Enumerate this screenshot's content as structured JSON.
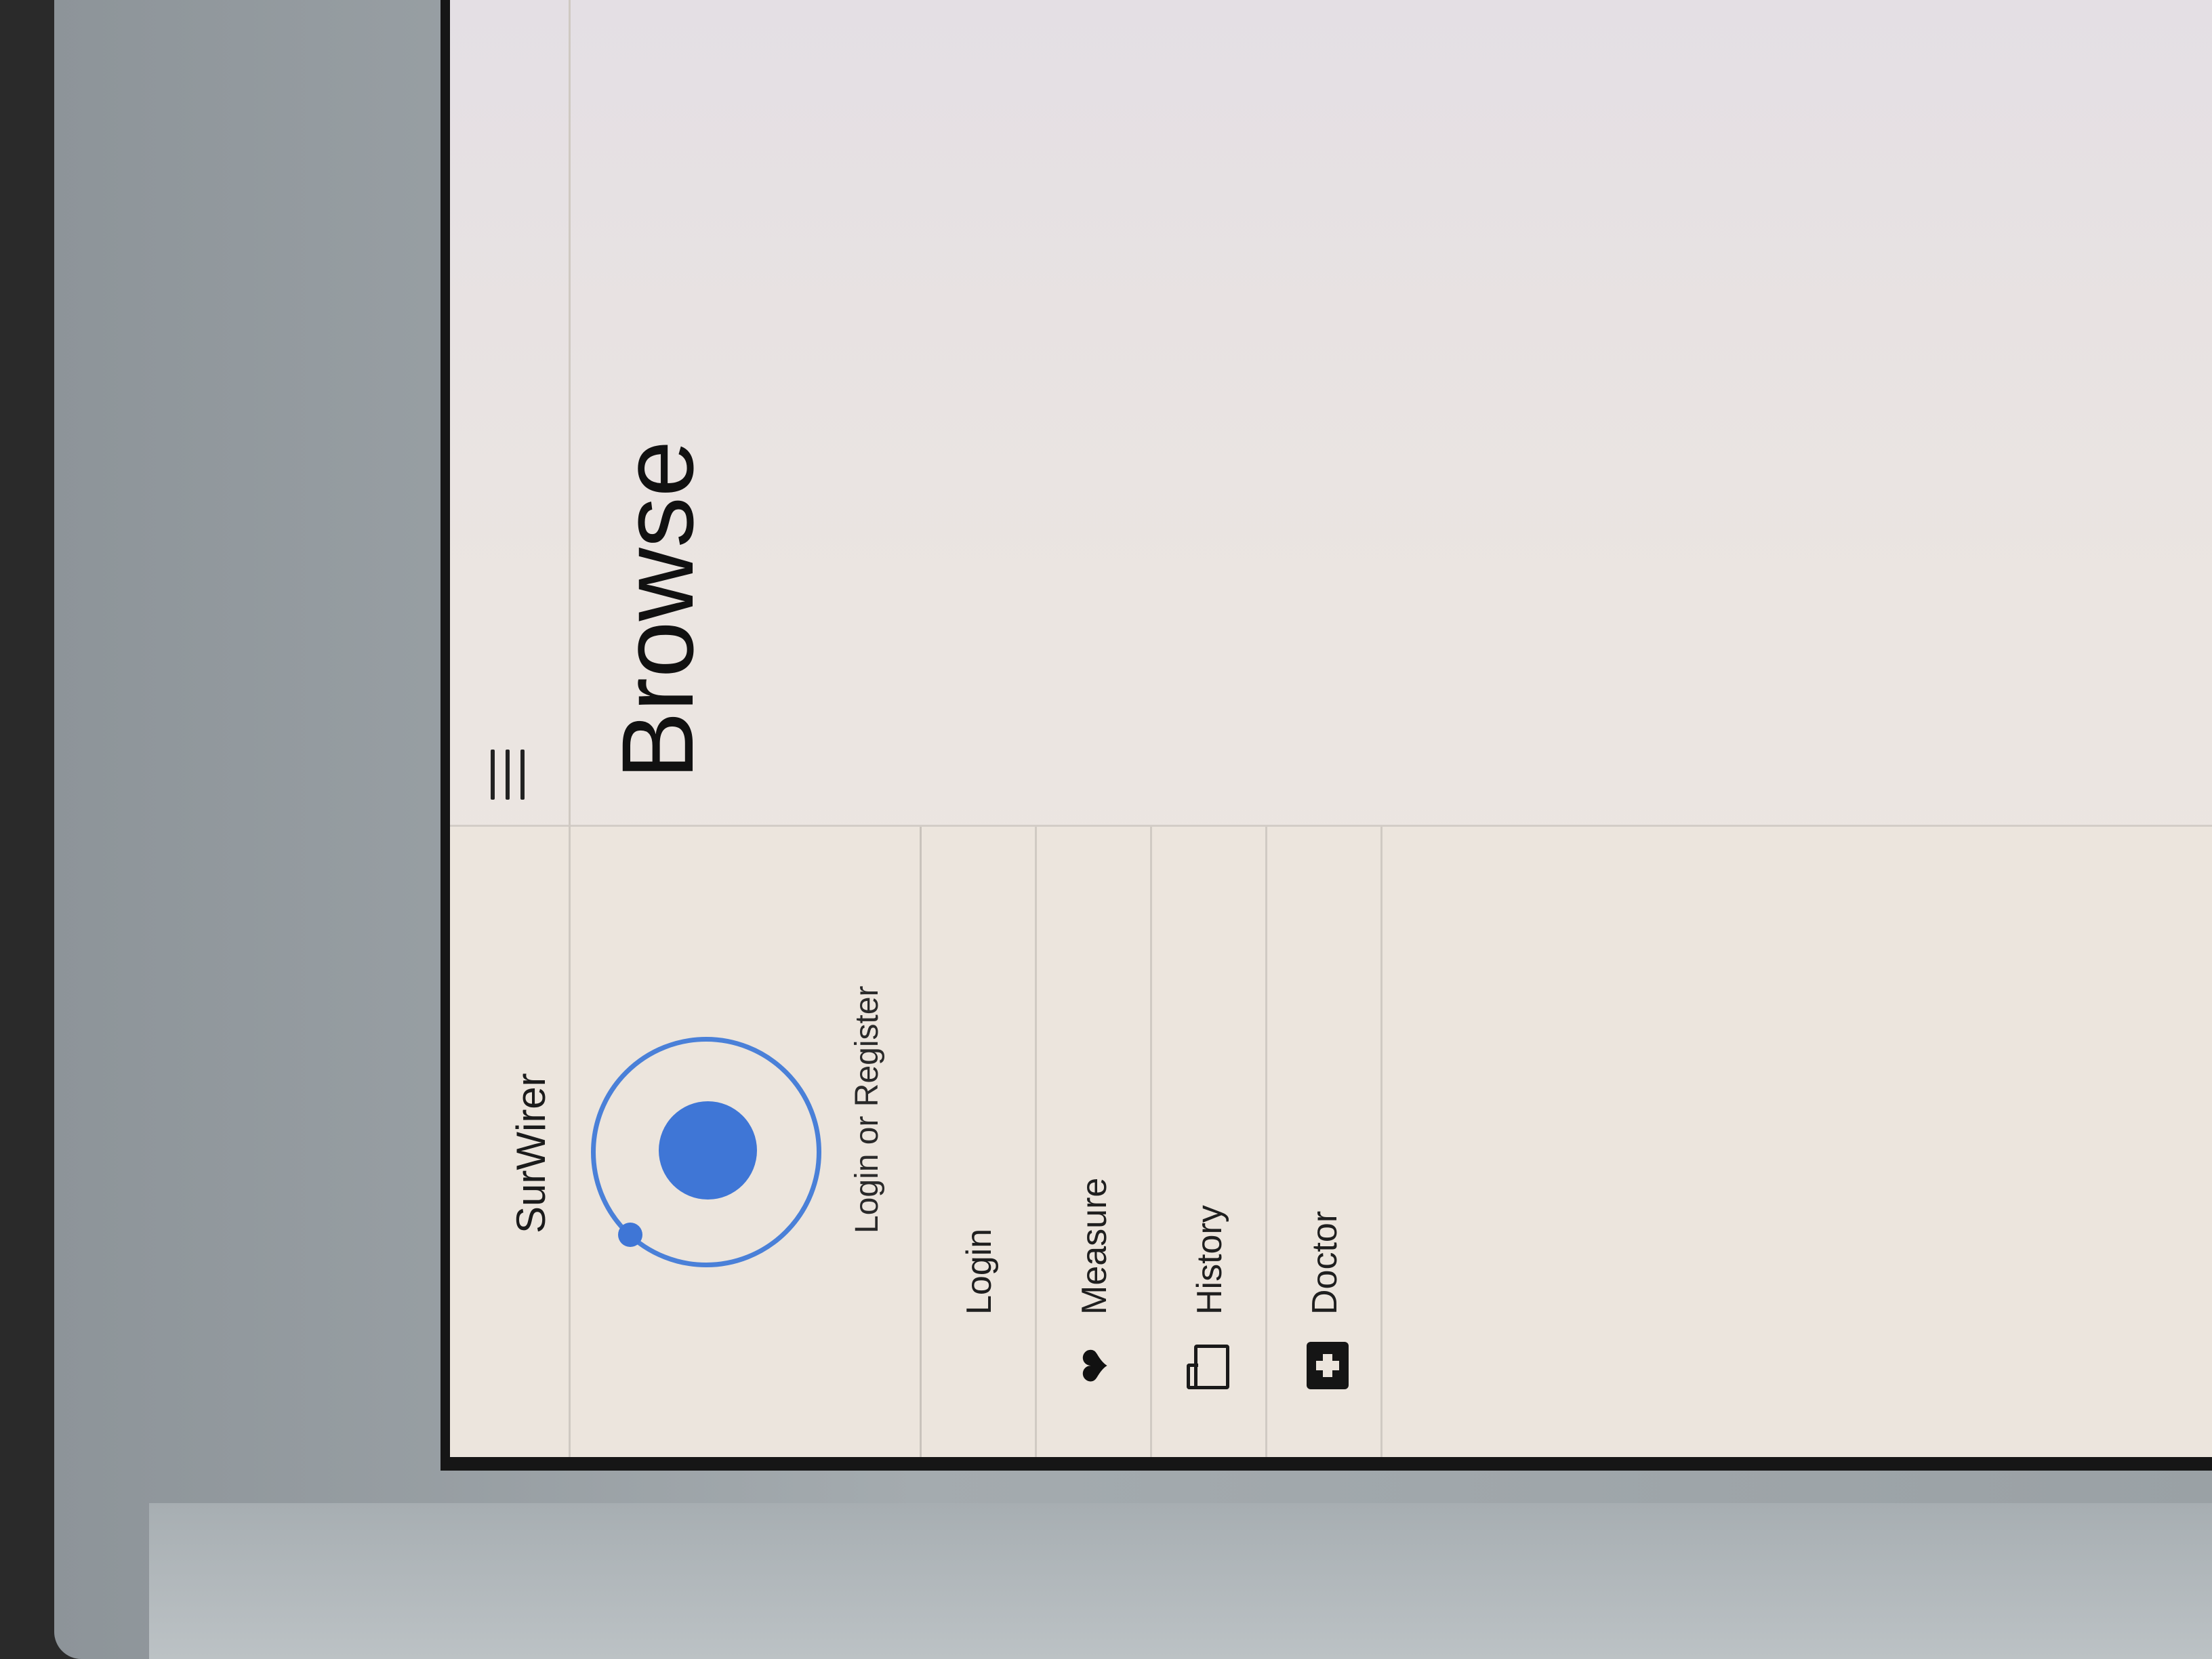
{
  "menu": {
    "title": "SurWirer",
    "profile_link": "Login or Register",
    "items": [
      {
        "label": "Login",
        "icon": ""
      },
      {
        "label": "Measure",
        "icon": "heart-icon"
      },
      {
        "label": "History",
        "icon": "folder-icon"
      },
      {
        "label": "Doctor",
        "icon": "medkit-icon"
      }
    ]
  },
  "main": {
    "title": "Browse",
    "menu_icon": "hamburger-icon"
  },
  "colors": {
    "accent": "#3f76d6",
    "background": "#ece5dd"
  }
}
